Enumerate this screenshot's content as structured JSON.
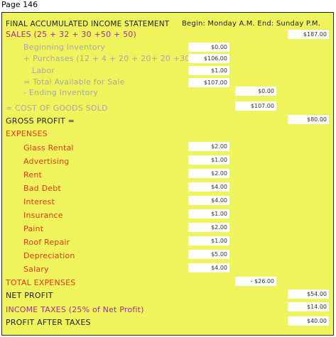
{
  "page_label": "Page 146",
  "header": {
    "title": "FINAL ACCUMULATED INCOME STATEMENT",
    "period": "Begin: Monday A.M.  End: Sunday P.M."
  },
  "sales": {
    "label": "SALES (25 + 32 + 30 +50 + 50)",
    "value": "$187.00"
  },
  "cogs_items": [
    {
      "label": "Beginning Inventory",
      "value": "$0.00"
    },
    {
      "label": "+ Purchases (12 + 4 + 20 + 20+ 20 +30)",
      "value": "$106.00"
    },
    {
      "label": "Labor",
      "value": "$1.00"
    },
    {
      "label": "= Total Available for Sale",
      "value": "$107.00"
    }
  ],
  "ending_inventory": {
    "label": "- Ending Inventory",
    "value": "$0.00"
  },
  "cogs": {
    "label": "= COST OF GOODS SOLD",
    "value": "$107.00"
  },
  "gross_profit": {
    "label": "GROSS PROFIT =",
    "value": "$80.00"
  },
  "expenses_heading": "EXPENSES",
  "expenses": [
    {
      "label": "Glass Rental",
      "value": "$2.00"
    },
    {
      "label": "Advertising",
      "value": "$1.00"
    },
    {
      "label": "Rent",
      "value": "$2.00"
    },
    {
      "label": "Bad Debt",
      "value": "$4.00"
    },
    {
      "label": "Interest",
      "value": "$4.00"
    },
    {
      "label": "Insurance",
      "value": "$1.00"
    },
    {
      "label": "Paint",
      "value": "$2.00"
    },
    {
      "label": "Roof Repair",
      "value": "$1.00"
    },
    {
      "label": "Depreciation",
      "value": "$5.00"
    },
    {
      "label": "Salary",
      "value": "$4.00"
    }
  ],
  "total_expenses": {
    "label": "TOTAL EXPENSES",
    "value": "- $26.00"
  },
  "net_profit": {
    "label": "NET PROFIT",
    "value": "$54.00"
  },
  "income_taxes": {
    "label": "INCOME TAXES (25% of Net Profit)",
    "value": "$14.00"
  },
  "profit_after_taxes": {
    "label": "PROFIT AFTER TAXES",
    "value": "$40.00"
  },
  "colors": {
    "background": "#f0f45c",
    "dark_text": "#222222",
    "purple_text": "#a0308c",
    "gray_text": "#a8a8a8",
    "red_text": "#e23a1a"
  }
}
